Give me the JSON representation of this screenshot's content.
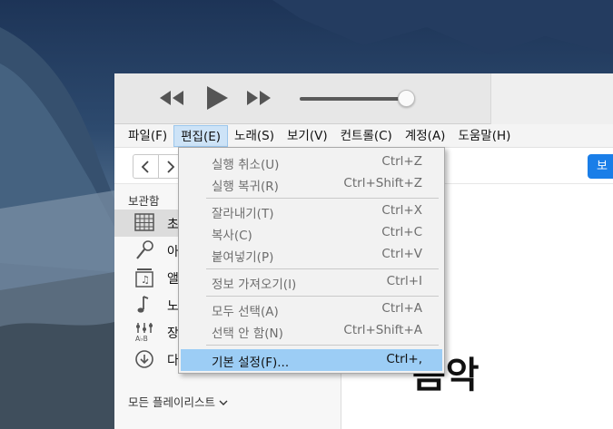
{
  "menubar": {
    "items": [
      "파일(F)",
      "편집(E)",
      "노래(S)",
      "보기(V)",
      "컨트롤(C)",
      "계정(A)",
      "도움말(H)"
    ],
    "active_index": 1
  },
  "nav": {
    "back_icon": "chevron-left-icon",
    "forward_icon": "chevron-right-icon",
    "blue_button_label": "보"
  },
  "sidebar": {
    "header": "보관함",
    "items": [
      {
        "label": "초",
        "icon": "grid-icon"
      },
      {
        "label": "아",
        "icon": "microphone-icon"
      },
      {
        "label": "앨",
        "icon": "album-icon"
      },
      {
        "label": "노",
        "icon": "music-note-icon"
      },
      {
        "label": "장",
        "icon": "genre-icon"
      },
      {
        "label": "다",
        "icon": "download-icon"
      }
    ],
    "all_playlists": "모든 플레이리스트"
  },
  "main": {
    "heading": "음악"
  },
  "edit_menu": {
    "items": [
      {
        "label": "실행 취소(U)",
        "shortcut": "Ctrl+Z"
      },
      {
        "label": "실행 복귀(R)",
        "shortcut": "Ctrl+Shift+Z"
      },
      {
        "label": "잘라내기(T)",
        "shortcut": "Ctrl+X"
      },
      {
        "label": "복사(C)",
        "shortcut": "Ctrl+C"
      },
      {
        "label": "붙여넣기(P)",
        "shortcut": "Ctrl+V"
      },
      {
        "label": "정보 가져오기(I)",
        "shortcut": "Ctrl+I"
      },
      {
        "label": "모두 선택(A)",
        "shortcut": "Ctrl+A"
      },
      {
        "label": "선택 안 함(N)",
        "shortcut": "Ctrl+Shift+A"
      },
      {
        "label": "기본 설정(F)...",
        "shortcut": "Ctrl+,"
      }
    ],
    "highlighted_index": 8
  },
  "colors": {
    "highlight": "#9ccdf5",
    "accent": "#1a7ee8"
  }
}
